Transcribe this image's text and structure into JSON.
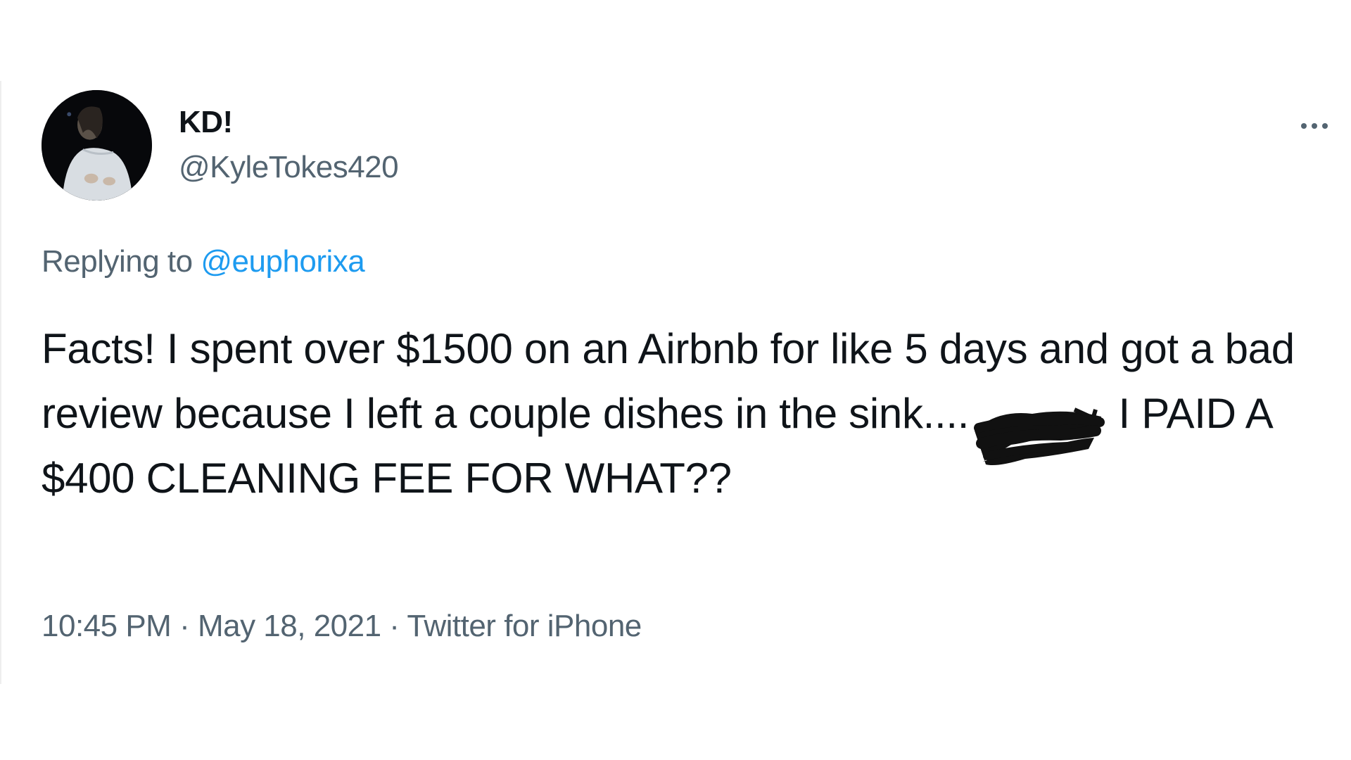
{
  "tweet": {
    "author": {
      "display_name": "KD!",
      "handle": "@KyleTokes420"
    },
    "reply": {
      "prefix": "Replying to ",
      "mention": "@euphorixa"
    },
    "text": {
      "part1": "Facts! I spent over $1500 on an Airbnb for like 5 days and got a bad review because I left a couple dishes in the sink....",
      "part2": " I PAID A $400 CLEANING FEE FOR WHAT??"
    },
    "meta": {
      "time": "10:45 PM",
      "separator1": " · ",
      "date": "May 18, 2021",
      "separator2": " · ",
      "source": "Twitter for iPhone"
    }
  },
  "icons": {
    "more": "more-horizontal-icon"
  },
  "colors": {
    "text_primary": "#0f1419",
    "text_secondary": "#536471",
    "accent": "#1d9bf0"
  }
}
